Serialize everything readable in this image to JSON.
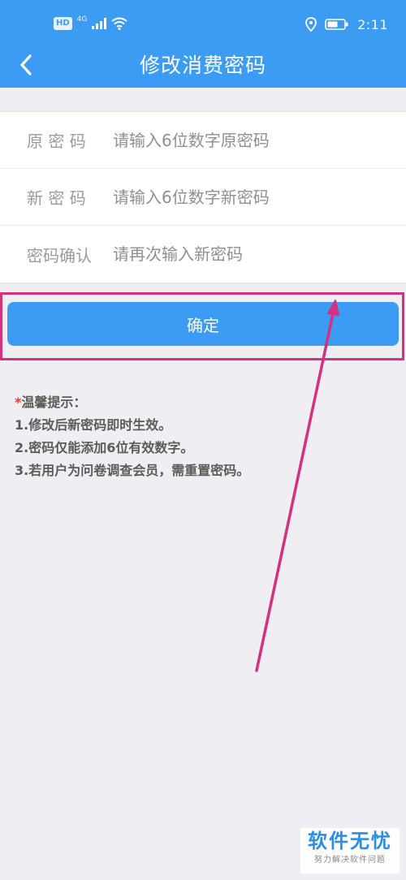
{
  "status_bar": {
    "hd": "HD",
    "network": "4G",
    "time": "2:11"
  },
  "nav": {
    "title": "修改消费密码"
  },
  "form": {
    "fields": [
      {
        "label": "原 密 码",
        "placeholder": "请输入6位数字原密码",
        "value": ""
      },
      {
        "label": "新 密 码",
        "placeholder": "请输入6位数字新密码",
        "value": ""
      },
      {
        "label": "密码确认",
        "placeholder": "请再次输入新密码",
        "value": ""
      }
    ]
  },
  "confirm_label": "确定",
  "tips": {
    "star": "*",
    "heading": "温馨提示：",
    "items": [
      "1.修改后新密码即时生效。",
      "2.密码仅能添加6位有效数字。",
      "3.若用户为问卷调查会员，需重置密码。"
    ]
  },
  "watermark": {
    "title": "软件无忧",
    "subtitle": "努力解决软件问题"
  },
  "colors": {
    "accent": "#3c9cf3",
    "annotation": "#d5317e",
    "background": "#efeef3"
  },
  "icons": [
    "hd-icon",
    "signal-icon",
    "wifi-icon",
    "location-icon",
    "battery-icon",
    "back-arrow-icon"
  ]
}
